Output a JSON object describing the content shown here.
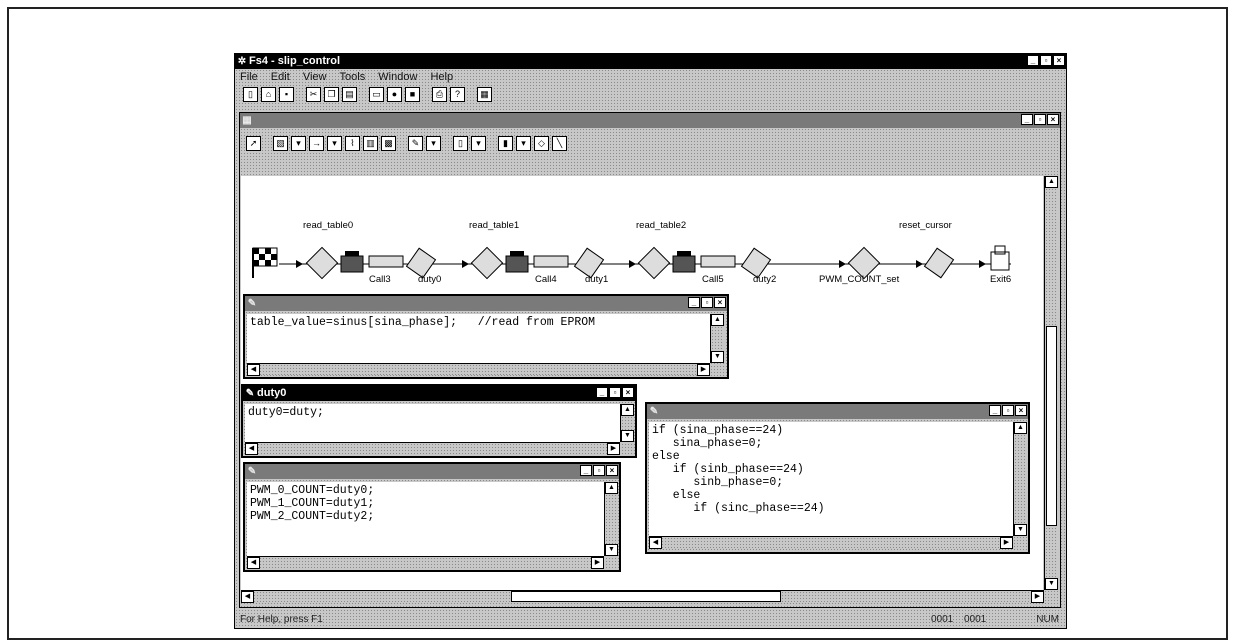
{
  "app": {
    "title": "Fs4 - slip_control",
    "menu": [
      "File",
      "Edit",
      "View",
      "Tools",
      "Window",
      "Help"
    ]
  },
  "diagram": {
    "nodes": {
      "read_table0": "read_table0",
      "read_table1": "read_table1",
      "read_table2": "read_table2",
      "reset_cursor": "reset_cursor",
      "call3": "Call3",
      "duty0": "duty0",
      "call4": "Call4",
      "duty1": "duty1",
      "call5": "Call5",
      "duty2": "duty2",
      "pwm_count_set": "PWM_COUNT_set",
      "exit6": "Exit6"
    }
  },
  "read_window": {
    "code": "table_value=sinus[sina_phase];   //read from EPROM"
  },
  "duty0_window": {
    "title": "duty0",
    "code": "duty0=duty;"
  },
  "pwm_window": {
    "code": "PWM_0_COUNT=duty0;\nPWM_1_COUNT=duty1;\nPWM_2_COUNT=duty2;"
  },
  "reset_window": {
    "code": "if (sina_phase==24)\n   sina_phase=0;\nelse\n   if (sinb_phase==24)\n      sinb_phase=0;\n   else\n      if (sinc_phase==24)"
  },
  "statusbar": {
    "help": "For Help, press F1",
    "pos1": "0001",
    "pos2": "0001",
    "num": "NUM"
  }
}
